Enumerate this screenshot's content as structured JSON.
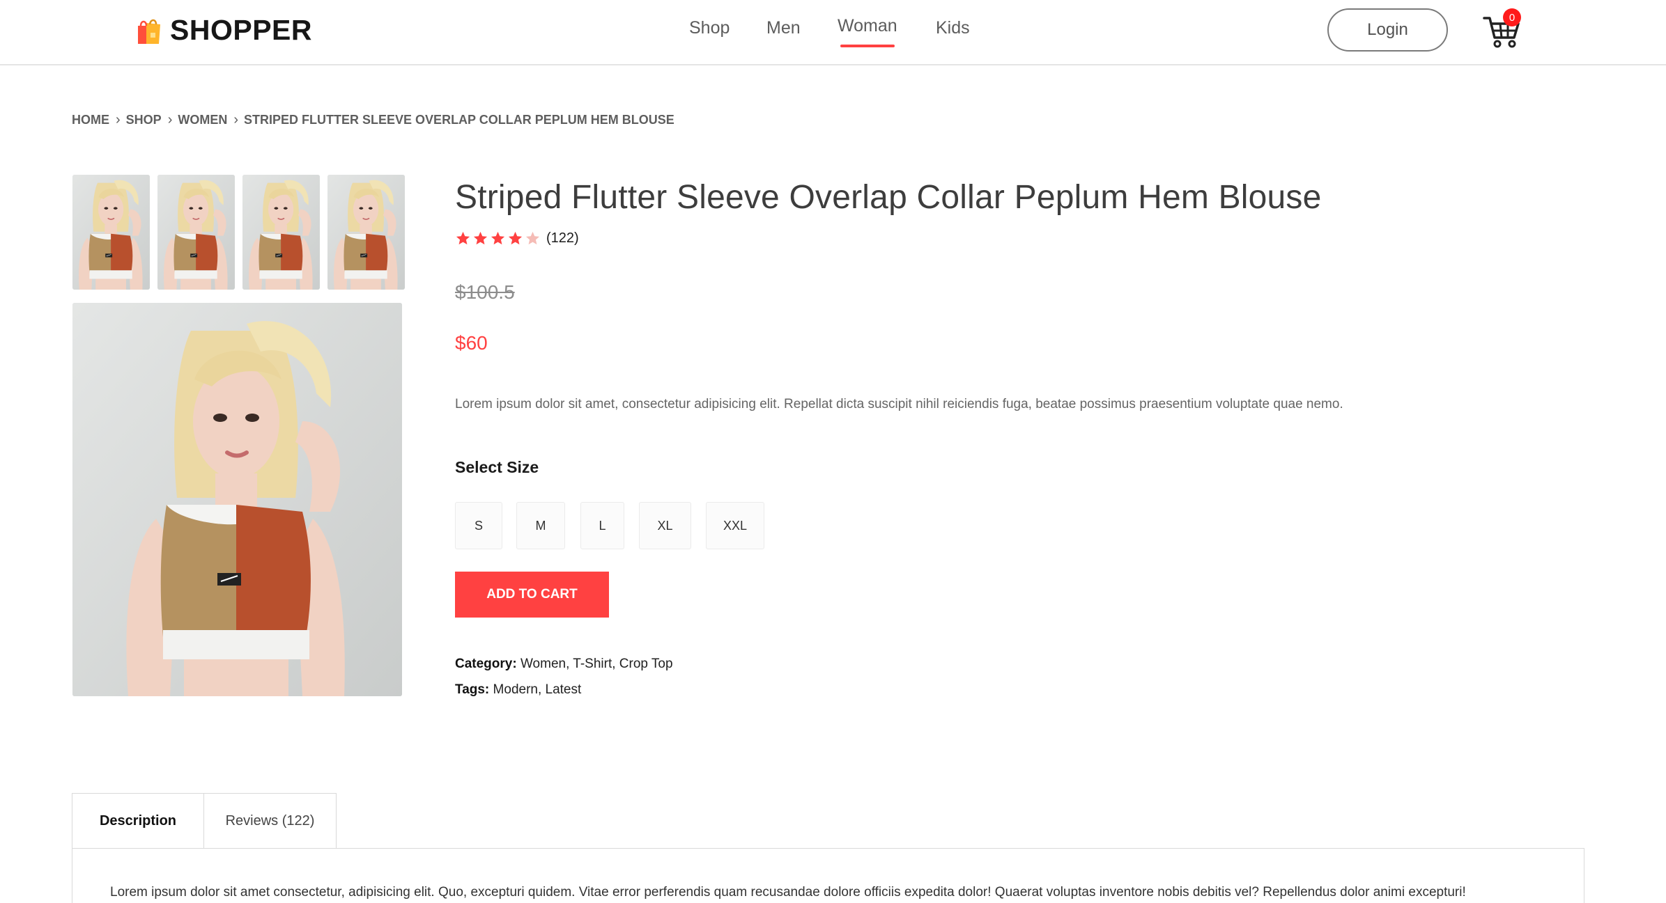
{
  "header": {
    "logo_text": "SHOPPER",
    "nav": [
      {
        "label": "Shop",
        "active": false
      },
      {
        "label": "Men",
        "active": false
      },
      {
        "label": "Woman",
        "active": true
      },
      {
        "label": "Kids",
        "active": false
      }
    ],
    "login_label": "Login",
    "cart_count": "0",
    "accent_color": "#ff4141"
  },
  "breadcrumb": [
    "HOME",
    "SHOP",
    "WOMEN",
    "STRIPED FLUTTER SLEEVE OVERLAP COLLAR PEPLUM HEM BLOUSE"
  ],
  "product": {
    "title": "Striped Flutter Sleeve Overlap Collar Peplum Hem Blouse",
    "rating": 4,
    "rating_max": 5,
    "review_count": "(122)",
    "old_price": "$100.5",
    "new_price": "$60",
    "description": "Lorem ipsum dolor sit amet, consectetur adipisicing elit. Repellat dicta suscipit nihil reiciendis fuga, beatae possimus praesentium voluptate quae nemo.",
    "size_title": "Select Size",
    "sizes": [
      "S",
      "M",
      "L",
      "XL",
      "XXL"
    ],
    "add_to_cart": "ADD TO CART",
    "category_label": "Category:",
    "category_value": " Women, T-Shirt, Crop Top",
    "tags_label": "Tags:",
    "tags_value": " Modern, Latest"
  },
  "tabs": {
    "items": [
      {
        "label": "Description",
        "active": true
      },
      {
        "label": "Reviews (122)",
        "active": false
      }
    ],
    "description_text": "Lorem ipsum dolor sit amet consectetur, adipisicing elit. Quo, excepturi quidem. Vitae error perferendis quam recusandae dolore officiis expedita dolor! Quaerat voluptas inventore nobis debitis vel? Repellendus dolor animi excepturi!"
  }
}
